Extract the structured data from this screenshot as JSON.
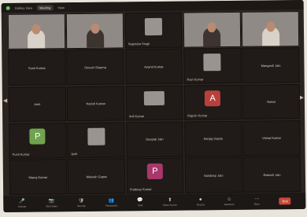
{
  "topbar": {
    "app_label": "Gallery View",
    "meeting_title": "Meeting",
    "view_label": "View"
  },
  "tiles": [
    {
      "label": "",
      "video": true,
      "kind": "light"
    },
    {
      "label": "",
      "video": true,
      "kind": "dark"
    },
    {
      "label": "Rajendra Singh",
      "video": false,
      "kind": "mini"
    },
    {
      "label": "",
      "video": true,
      "kind": "dark"
    },
    {
      "label": "",
      "video": true,
      "kind": "light"
    },
    {
      "center": "Sunil Kumar",
      "video": false
    },
    {
      "center": "Dinesh Sharma",
      "video": false
    },
    {
      "center": "Anand Kumar",
      "video": false
    },
    {
      "label": "Ravi Kumar",
      "video": false,
      "kind": "mini"
    },
    {
      "center": "Mangesh Jain",
      "video": false
    },
    {
      "center": "Amit",
      "video": false
    },
    {
      "center": "Harish Kumar",
      "video": false
    },
    {
      "label": "Anil Kumar",
      "video": false,
      "kind": "miniwide"
    },
    {
      "label": "Rajesh Kumar",
      "video": false,
      "kind": "avatar",
      "letter": "A",
      "color": "#b8403c"
    },
    {
      "center": "Rahul",
      "video": false
    },
    {
      "label": "Punit Kumar",
      "video": false,
      "kind": "avatar",
      "letter": "P",
      "color": "#6fa34e"
    },
    {
      "label": "Jyoti",
      "video": false,
      "kind": "mini"
    },
    {
      "center": "Deepak Jain",
      "video": false
    },
    {
      "center": "Sanjay Gupta",
      "video": false
    },
    {
      "center": "Vishal Kumar",
      "video": false
    },
    {
      "center": "Manoj Kumar",
      "video": false
    },
    {
      "center": "Mukesh Gupta",
      "video": false
    },
    {
      "label": "Pradeep Kumar",
      "video": false,
      "kind": "avatar",
      "letter": "P",
      "color": "#a8376a"
    },
    {
      "center": "Sandeep Jain",
      "video": false
    },
    {
      "center": "Rakesh Jain",
      "video": false
    }
  ],
  "toolbar": {
    "items": [
      {
        "icon": "🎤",
        "label": "Unmute"
      },
      {
        "icon": "📷",
        "label": "Start Video"
      },
      {
        "icon": "🛡",
        "label": "Security"
      },
      {
        "icon": "👥",
        "label": "Participants"
      },
      {
        "icon": "💬",
        "label": "Chat"
      },
      {
        "icon": "⬆",
        "label": "Share Screen"
      },
      {
        "icon": "⏺",
        "label": "Record"
      },
      {
        "icon": "☺",
        "label": "Reactions"
      },
      {
        "icon": "⋯",
        "label": "More"
      }
    ],
    "end_label": "End"
  }
}
